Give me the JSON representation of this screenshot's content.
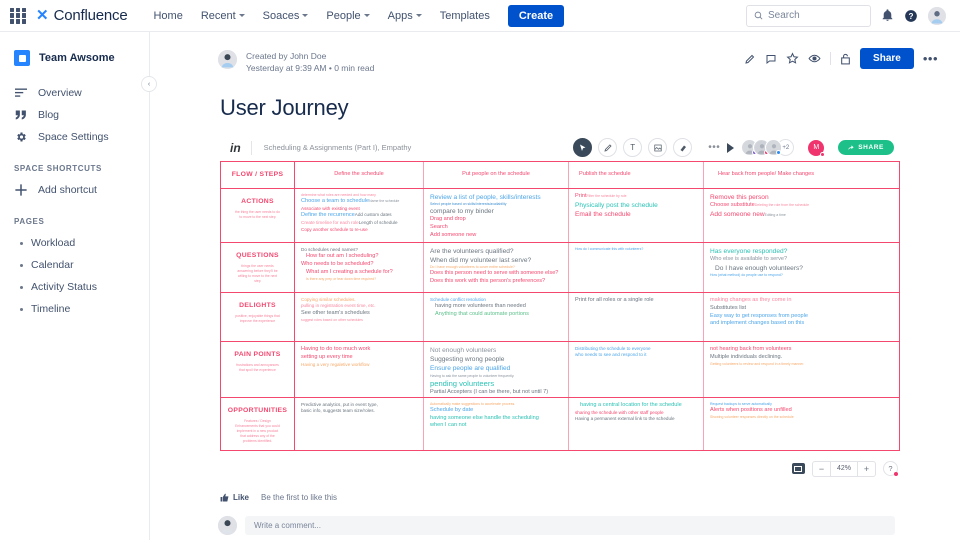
{
  "topnav": {
    "apps_icon": "apps-grid-icon",
    "brand": {
      "mark": "✕",
      "name": "Confluence"
    },
    "items": [
      {
        "label": "Home",
        "caret": false
      },
      {
        "label": "Recent",
        "caret": true
      },
      {
        "label": "Soaces",
        "caret": true
      },
      {
        "label": "People",
        "caret": true
      },
      {
        "label": "Apps",
        "caret": true
      },
      {
        "label": "Templates",
        "caret": false
      }
    ],
    "create_label": "Create",
    "search_placeholder": "Search",
    "notifications_icon": "bell-icon",
    "help_icon": "help-icon",
    "profile_icon": "avatar-icon",
    "accent": "#0052cc"
  },
  "sidebar": {
    "space_name": "Team Awsome",
    "collapse_icon": "chevron-left-icon",
    "items": [
      {
        "label": "Overview",
        "icon": "overview-icon"
      },
      {
        "label": "Blog",
        "icon": "quote-icon"
      },
      {
        "label": "Space Settings",
        "icon": "gear-icon"
      }
    ],
    "shortcuts_heading": "SPACE SHORTCUTS",
    "add_shortcut": "Add shortcut",
    "pages_heading": "PAGES",
    "pages": [
      "Workload",
      "Calendar",
      "Activity Status",
      "Timeline"
    ]
  },
  "page": {
    "created_by": "Created by John Doe",
    "meta_line": "Yesterday at 9:39 AM  •  0 min read",
    "title": "User Journey",
    "actions": [
      "edit-icon",
      "comment-icon",
      "star-icon",
      "watch-icon",
      "restrictions-icon"
    ],
    "share_label": "Share",
    "more_label": "•••"
  },
  "embed": {
    "logo": "in",
    "title": "Scheduling & Assignments (Part I), Empathy",
    "tools": [
      "cursor-tool",
      "pencil-tool",
      "text-tool",
      "shape-tool",
      "eraser-tool"
    ],
    "more_label": "•••",
    "play_icon": "play-icon",
    "avatar_overflow": "+2",
    "owner_initial": "M",
    "share_label": "SHARE",
    "share_color": "#1ec08a",
    "zoom": {
      "fit_icon": "fit-screen-icon",
      "minus": "−",
      "value": "42%",
      "plus": "+",
      "help": "?"
    }
  },
  "journey": {
    "row_labels": [
      {
        "name": "FLOW / STEPS",
        "sub": ""
      },
      {
        "name": "ACTIONS",
        "sub": "the thing the user needs to do to move to the next step"
      },
      {
        "name": "QUESTIONS",
        "sub": "things the user needs answering before they'll be willing to move to the next step"
      },
      {
        "name": "DELIGHTS",
        "sub": "positive, enjoyable things that improve the experience"
      },
      {
        "name": "PAIN POINTS",
        "sub": "frustrations and annoyances that spoil the experience"
      },
      {
        "name": "OPPORTUNITIES",
        "sub": "Features / Design Enhancements that you could implement in a new product that address any of the problems identified."
      }
    ],
    "steps": [
      "Define the schedule",
      "Put people on the schedule",
      "Publish the schedule",
      "Hear back from people/ Make changes"
    ],
    "actions": {
      "step1": [
        {
          "t": "determine what roles are needed and how many",
          "c": "pink-l",
          "s": "xs"
        },
        {
          "t": "Choose a team to schedule",
          "c": "blue",
          "s": "md",
          "after": {
            "t": "Name the schedule",
            "c": "gray",
            "s": "xs"
          }
        },
        {
          "t": "Associate with existing event",
          "c": "pink",
          "s": "sm"
        },
        {
          "t": "Define the recurrence",
          "c": "blue",
          "s": "md",
          "after": {
            "t": "Add custom dates",
            "c": "gray-d",
            "s": "sm"
          }
        },
        {
          "t": "Create timeline for each role",
          "c": "pink-l",
          "s": "sm",
          "after": {
            "t": "Length of schedule",
            "c": "gray-d",
            "s": "sm"
          }
        },
        {
          "t": "Copy another schedule to re-use",
          "c": "pink",
          "s": "sm"
        }
      ],
      "step2": [
        {
          "t": "Review a list of people, skills/interests",
          "c": "blue",
          "s": "lg"
        },
        {
          "t": "Select people based on skills/interests/availability",
          "c": "blue-d",
          "s": "xs"
        },
        {
          "t": "compare to my binder",
          "c": "gray-d",
          "s": "lg"
        },
        {
          "t": "Drag and drop",
          "c": "pink",
          "s": "md"
        },
        {
          "t": "Search",
          "c": "pink",
          "s": "md"
        },
        {
          "t": "Add someone new",
          "c": "pink",
          "s": "md"
        }
      ],
      "step3": [
        {
          "t": "Print",
          "c": "pink",
          "s": "md",
          "after": {
            "t": "Filter the schedule by role",
            "c": "pink-l",
            "s": "xs"
          }
        },
        {
          "t": "Physically post the schedule",
          "c": "teal",
          "s": "lg"
        },
        {
          "t": "Email the schedule",
          "c": "pink",
          "s": "lg"
        }
      ],
      "step4": [
        {
          "t": "Remove this person",
          "c": "pink",
          "s": "lg"
        },
        {
          "t": "Choose substitute",
          "c": "pink",
          "s": "md",
          "after": {
            "t": "Deleting the role from the schedule",
            "c": "pink-l",
            "s": "xs"
          }
        },
        {
          "t": "Add someone new",
          "c": "pink",
          "s": "lg",
          "after": {
            "t": "Editing a time",
            "c": "gray",
            "s": "xs"
          }
        }
      ]
    },
    "questions": {
      "step1": [
        {
          "t": "Do schedules need names?",
          "c": "gray-d",
          "s": "sm"
        },
        {
          "t": "How far out am I scheduling?",
          "c": "pink",
          "s": "md",
          "i": 1
        },
        {
          "t": "Who needs to be scheduled?",
          "c": "pink",
          "s": "md"
        },
        {
          "t": "What am I creating a schedule for?",
          "c": "pink",
          "s": "md",
          "i": 1
        },
        {
          "t": "Is there any prep or tear down time required?",
          "c": "orange",
          "s": "xs",
          "i": 1
        }
      ],
      "step2": [
        {
          "t": "Are the volunteers qualified?",
          "c": "gray-d",
          "s": "lg"
        },
        {
          "t": "When did my volunteer last serve?",
          "c": "gray-d",
          "s": "lg"
        },
        {
          "t": "Do I have enough volunteers to cover entire schedule?",
          "c": "orange",
          "s": "xs"
        },
        {
          "t": "Does this person need to serve with someone else?",
          "c": "pink",
          "s": "md"
        },
        {
          "t": "Does this work with this person's preferences?",
          "c": "pink",
          "s": "md"
        }
      ],
      "step3": [
        {
          "t": "How do I communicate this with volunteers?",
          "c": "blue",
          "s": "xs"
        }
      ],
      "step4": [
        {
          "t": "Has everyone responded?",
          "c": "teal",
          "s": "lg"
        },
        {
          "t": "Who else is available to serve?",
          "c": "gray",
          "s": "md"
        },
        {
          "t": "Do I have enough volunteers?",
          "c": "gray-d",
          "s": "lg",
          "i": 1
        },
        {
          "t": "How (what method) do people use to respond?",
          "c": "blue",
          "s": "xs"
        }
      ]
    },
    "delights": {
      "step1": [
        {
          "t": "Copying similar schedules.",
          "c": "orange",
          "s": "sm"
        },
        {
          "t": "pulling in registration event time, etc.",
          "c": "pink-l",
          "s": "sm"
        },
        {
          "t": "See other team's schedules",
          "c": "gray-d",
          "s": "md"
        },
        {
          "t": "suggest roles based on other schedules",
          "c": "pink-l",
          "s": "xs"
        }
      ],
      "step2": [
        {
          "t": "Schedule conflict resolution",
          "c": "blue",
          "s": "sm"
        },
        {
          "t": "having more volunteers than needed",
          "c": "gray-d",
          "s": "md",
          "i": 1
        },
        {
          "t": "Anything that could automate portions",
          "c": "green",
          "s": "md",
          "i": 1
        }
      ],
      "step3": [
        {
          "t": "Print for all roles or a single role",
          "c": "gray-d",
          "s": "md"
        }
      ],
      "step4": [
        {
          "t": "making changes as they come in",
          "c": "pink-l",
          "s": "md"
        },
        {
          "t": "Substitutes list",
          "c": "gray-d",
          "s": "md"
        },
        {
          "t": "Easy way to get responses from people",
          "c": "blue",
          "s": "md"
        },
        {
          "t": "and implement changes based on this",
          "c": "blue",
          "s": "md"
        }
      ]
    },
    "painpoints": {
      "step1": [
        {
          "t": "Having to do too much work",
          "c": "pink",
          "s": "md"
        },
        {
          "t": "setting up every time",
          "c": "pink",
          "s": "md"
        },
        {
          "t": "Having a very regaletive workflow",
          "c": "orange",
          "s": "sm"
        }
      ],
      "step2": [
        {
          "t": "Not enough volunteers",
          "c": "gray",
          "s": "lg"
        },
        {
          "t": "Suggesting wrong people",
          "c": "gray-d",
          "s": "lg"
        },
        {
          "t": "Ensure people are qualified",
          "c": "blue",
          "s": "lg"
        },
        {
          "t": "Having to ask the same people to volunteer frequently.",
          "c": "gray",
          "s": "xs"
        },
        {
          "t": "pending volunteers",
          "c": "teal",
          "s": "xl"
        },
        {
          "t": "Partial Accepters (I can be there, but not until 7)",
          "c": "gray-d",
          "s": "md"
        }
      ],
      "step3": [
        {
          "t": "Distributing the schedule to everyone",
          "c": "blue",
          "s": "sm"
        },
        {
          "t": "who needs to see and respond to it",
          "c": "blue",
          "s": "sm"
        }
      ],
      "step4": [
        {
          "t": "not hearing back from volunteers",
          "c": "pink",
          "s": "md"
        },
        {
          "t": "Multiple individuals declining.",
          "c": "gray-d",
          "s": "md"
        },
        {
          "t": "Getting volunteers to review and respond in a timely manner.",
          "c": "orange",
          "s": "xs"
        }
      ]
    },
    "opportunities": {
      "step1": [
        {
          "t": "Predictive analytics, put in event type,",
          "c": "gray-d",
          "s": "sm"
        },
        {
          "t": "basic info, suggests team size/roles.",
          "c": "gray-d",
          "s": "sm"
        }
      ],
      "step2": [
        {
          "t": "Automatically make suggestions to accelerate process.",
          "c": "orange",
          "s": "xs"
        },
        {
          "t": "Schedule by date",
          "c": "blue",
          "s": "md"
        },
        {
          "t": "having someone else handle the scheduling",
          "c": "teal",
          "s": "md"
        },
        {
          "t": "when I can not",
          "c": "teal",
          "s": "md"
        }
      ],
      "step3": [
        {
          "t": "having a central location for the schedule",
          "c": "teal",
          "s": "md",
          "i": 1
        },
        {
          "t": "sharing the schedule with other staff people",
          "c": "pink",
          "s": "sm"
        },
        {
          "t": "Having a permanent external link to the schedule",
          "c": "gray-d",
          "s": "sm"
        }
      ],
      "step4": [
        {
          "t": "Request backups to serve automatically",
          "c": "blue",
          "s": "xs"
        },
        {
          "t": "Alerts when positions are unfilled",
          "c": "pink",
          "s": "md"
        },
        {
          "t": "Showing volunteer responses directly on the schedule",
          "c": "orange",
          "s": "xs"
        }
      ]
    }
  },
  "footer": {
    "like_label": "Like",
    "like_note": "Be the first to like this",
    "comment_placeholder": "Write a comment..."
  }
}
